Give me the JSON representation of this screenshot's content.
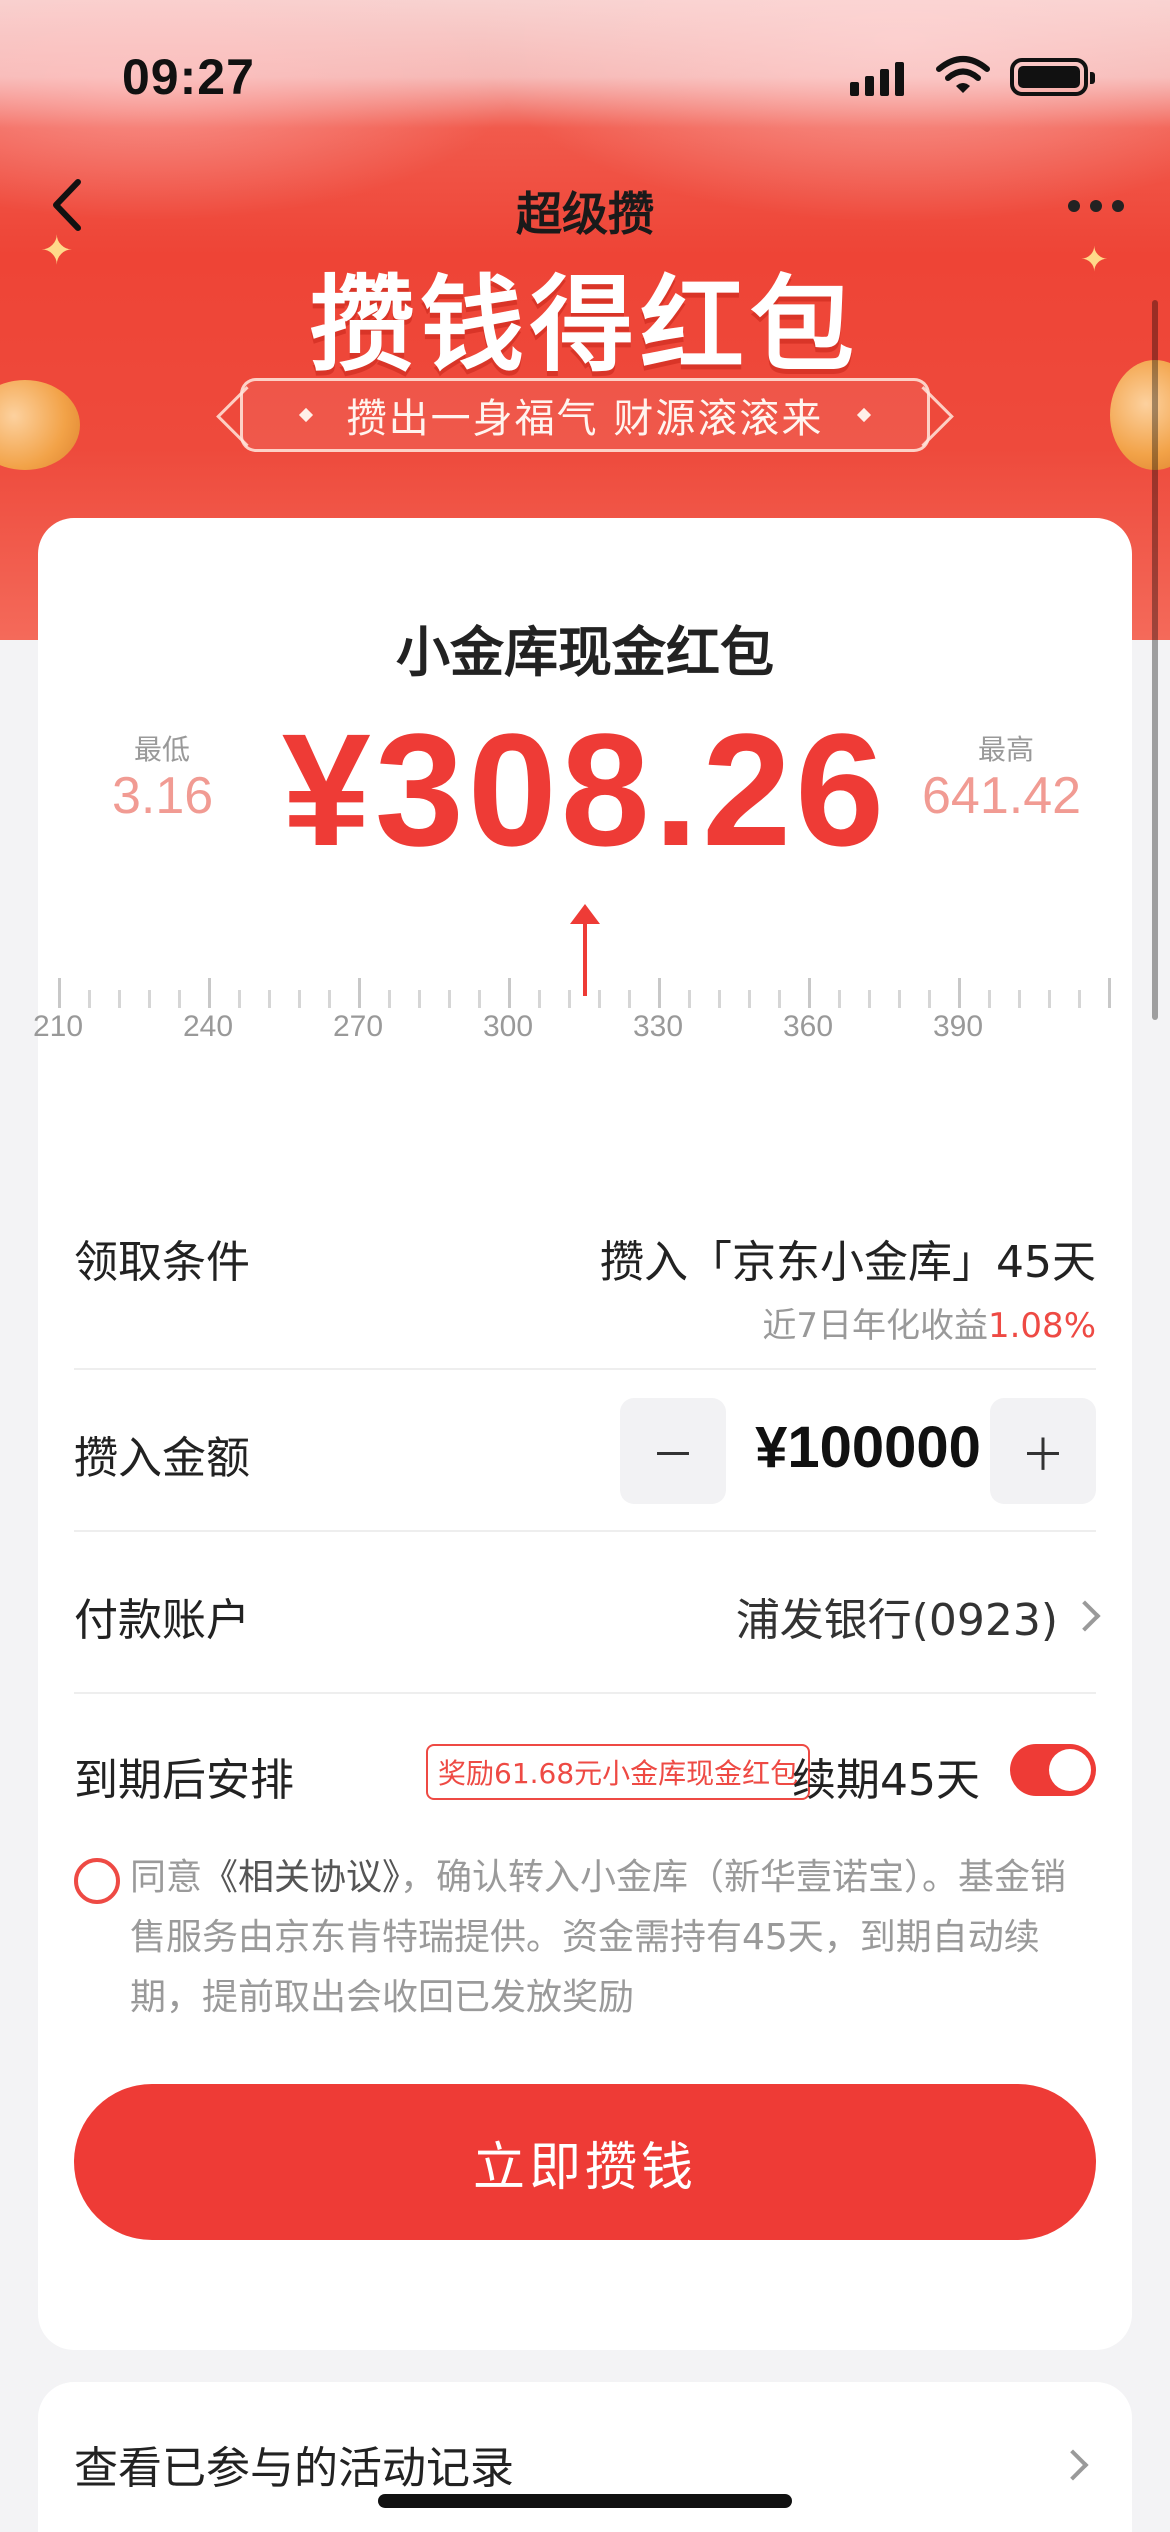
{
  "status_bar": {
    "time": "09:27"
  },
  "nav": {
    "title": "超级攒"
  },
  "banner": {
    "title": "攒钱得红包",
    "subtitle": "攒出一身福气 财源滚滚来"
  },
  "card": {
    "title": "小金库现金红包",
    "amount": "¥308.26",
    "min_label": "最低",
    "min_value": "3.16",
    "max_label": "最高",
    "max_value": "641.42",
    "scale_labels": [
      "210",
      "240",
      "270",
      "300",
      "330",
      "360",
      "390"
    ],
    "condition": {
      "label": "领取条件",
      "value": "攒入「京东小金库」45天",
      "yield_prefix": "近7日年化收益",
      "yield_value": "1.08%"
    },
    "deposit": {
      "label": "攒入金额",
      "minus": "－",
      "value": "¥100000",
      "plus": "＋"
    },
    "account": {
      "label": "付款账户",
      "value": "浦发银行(0923)"
    },
    "maturity": {
      "label": "到期后安排",
      "reward_badge": "奖励61.68元小金库现金红包",
      "renew": "续期45天",
      "toggle_on": true
    },
    "agreement": {
      "prefix": "同意",
      "link": "《相关协议》",
      "text": "，确认转入小金库（新华壹诺宝）。基金销售服务由京东肯特瑞提供。资金需持有45天，到期自动续期，提前取出会收回已发放奖励"
    },
    "cta": "立即攒钱"
  },
  "history": {
    "label": "查看已参与的活动记录"
  }
}
